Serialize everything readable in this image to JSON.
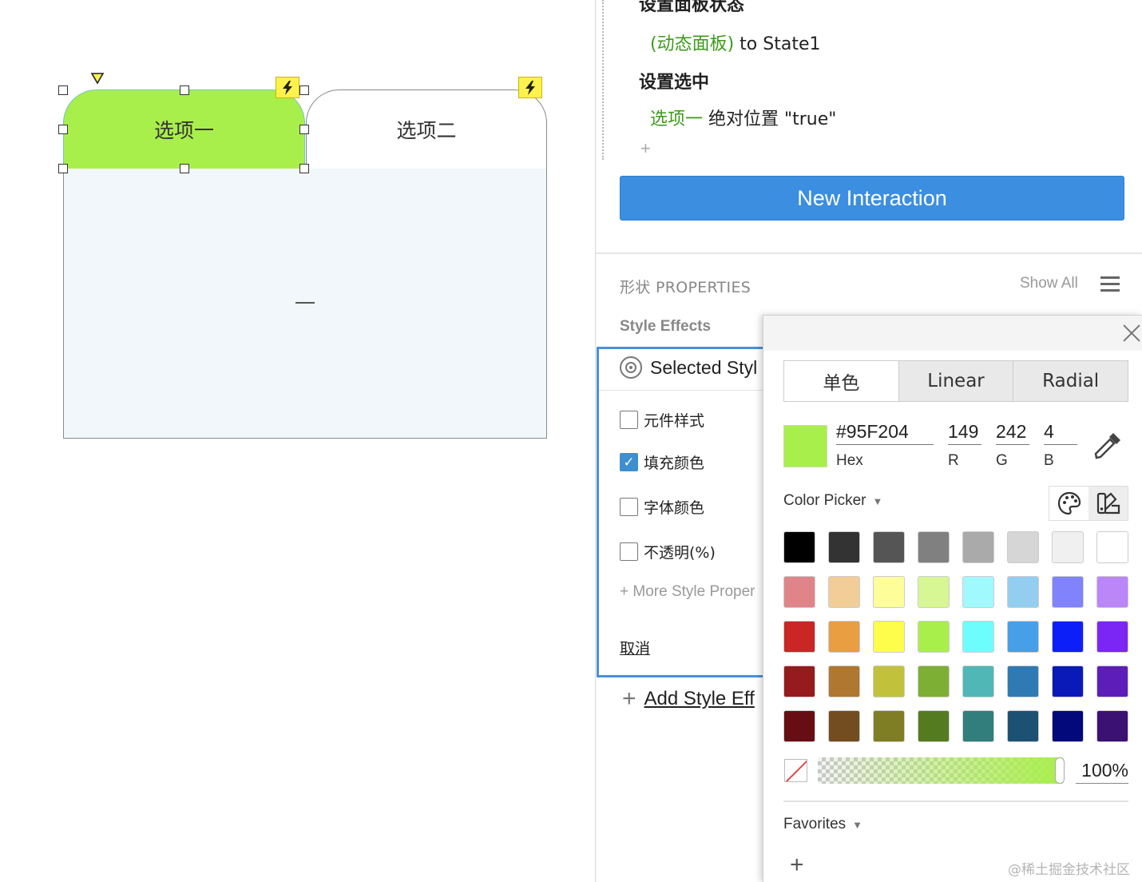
{
  "canvas": {
    "tabs": [
      {
        "label": "选项一"
      },
      {
        "label": "选项二"
      }
    ],
    "panel_marker": "—",
    "selected_tab_color": "#a9ef4b"
  },
  "interactions": {
    "action1_title": "设置面板状态",
    "action1_target": "(动态面板)",
    "action1_value": " to State1",
    "action2_title": "设置选中",
    "action2_target": "选项一",
    "action2_value": " 绝对位置 \"true\"",
    "add_action": "+",
    "new_interaction_label": "New Interaction"
  },
  "properties": {
    "title": "形状 PROPERTIES",
    "show_all": "Show All",
    "menu_icon": "hamburger-icon",
    "style_effects_label": "Style Effects",
    "selected_style_label": "Selected Styl",
    "checkboxes": [
      {
        "label": "元件样式",
        "checked": false
      },
      {
        "label": "填充颜色",
        "checked": true
      },
      {
        "label": "字体颜色",
        "checked": false
      },
      {
        "label": "不透明(%)",
        "checked": false
      }
    ],
    "more_props": "+ More Style Proper",
    "cancel": "取消",
    "add_style_plus": "+",
    "add_style": "Add Style Eff"
  },
  "color_picker": {
    "tabs": [
      "单色",
      "Linear",
      "Radial"
    ],
    "active_tab": "单色",
    "current_color": "#95F204",
    "hex": "#95F204",
    "r": "149",
    "g": "242",
    "b": "4",
    "hex_label": "Hex",
    "r_label": "R",
    "g_label": "G",
    "b_label": "B",
    "picker_label": "Color Picker",
    "picker_modes": [
      "palette-icon",
      "swatches-icon"
    ],
    "swatches": [
      [
        "#000000",
        "#333333",
        "#555555",
        "#808080",
        "#aaaaaa",
        "#d6d6d6",
        "#f0f0f0",
        "#ffffff"
      ],
      [
        "#df8589",
        "#f2cd97",
        "#fdfd9a",
        "#d6f793",
        "#9ff9fd",
        "#93cef0",
        "#8083fb",
        "#bb86f8"
      ],
      [
        "#cb2626",
        "#ea9e42",
        "#fefd4b",
        "#a9ef4b",
        "#6efdfd",
        "#47a0e7",
        "#0c1ff9",
        "#7b26f4"
      ],
      [
        "#951b1c",
        "#af772f",
        "#c1c13b",
        "#7caf33",
        "#50b7b6",
        "#2f7ab3",
        "#0a1ab8",
        "#5d1db8"
      ],
      [
        "#670e14",
        "#734c20",
        "#7f7e24",
        "#557b21",
        "#317e7c",
        "#1d5173",
        "#03087a",
        "#3b1174"
      ]
    ],
    "opacity": "100%",
    "opacity_fraction": 1.0,
    "favorites_label": "Favorites",
    "favorites_add": "+"
  },
  "watermark": "@稀土掘金技术社区"
}
